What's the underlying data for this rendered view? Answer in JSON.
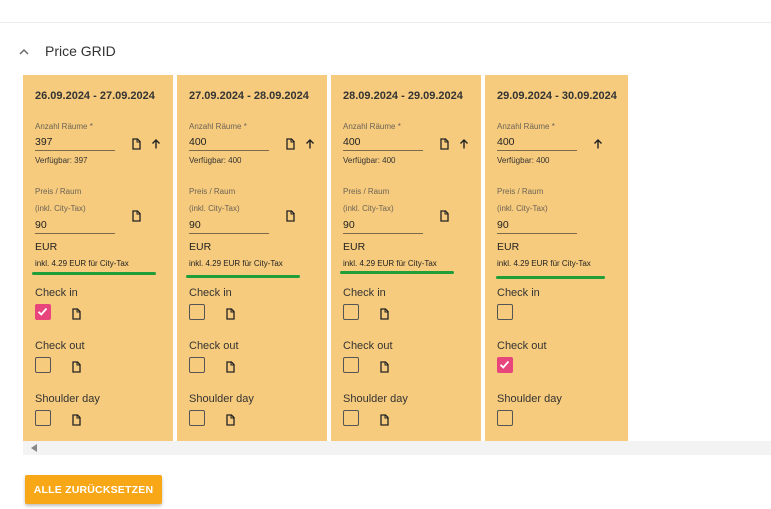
{
  "section": {
    "title": "Price GRID",
    "icon": "chevron-up-icon"
  },
  "labels": {
    "rooms": "Anzahl Räume *",
    "price_line1": "Preis / Raum",
    "price_line2": "(inkl. City-Tax)",
    "check_in": "Check in",
    "check_out": "Check out",
    "shoulder_day": "Shoulder day"
  },
  "cards": [
    {
      "date": "26.09.2024 - 27.09.2024",
      "rooms": "397",
      "available": "Verfügbar: 397",
      "price": "90",
      "currency": "EUR",
      "tax": "inkl. 4.29 EUR für City-Tax",
      "check_in": true,
      "check_out": false,
      "shoulder_day": false
    },
    {
      "date": "27.09.2024 - 28.09.2024",
      "rooms": "400",
      "available": "Verfügbar: 400",
      "price": "90",
      "currency": "EUR",
      "tax": "inkl. 4.29 EUR für City-Tax",
      "check_in": false,
      "check_out": false,
      "shoulder_day": false
    },
    {
      "date": "28.09.2024 - 29.09.2024",
      "rooms": "400",
      "available": "Verfügbar: 400",
      "price": "90",
      "currency": "EUR",
      "tax": "inkl. 4.29 EUR für City-Tax",
      "check_in": false,
      "check_out": false,
      "shoulder_day": false
    },
    {
      "date": "29.09.2024 - 30.09.2024",
      "rooms": "400",
      "available": "Verfügbar: 400",
      "price": "90",
      "currency": "EUR",
      "tax": "inkl. 4.29 EUR für City-Tax",
      "check_in": false,
      "check_out": true,
      "shoulder_day": false
    }
  ],
  "colors": {
    "card_bg": "#f7cb7d",
    "checkbox_checked": "#e8457c",
    "underline": "#1f9e3a",
    "button_bg": "#f8a717"
  },
  "reset_button": {
    "label": "ALLE ZURÜCKSETZEN"
  }
}
